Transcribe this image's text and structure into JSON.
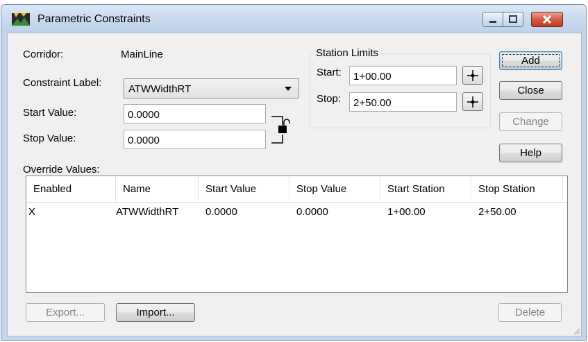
{
  "window": {
    "title": "Parametric Constraints",
    "icon": "app-icon"
  },
  "form": {
    "corridor_label": "Corridor:",
    "corridor_value": "MainLine",
    "constraint_label_label": "Constraint Label:",
    "constraint_label_value": "ATWWidthRT",
    "start_value_label": "Start Value:",
    "start_value": "0.0000",
    "stop_value_label": "Stop Value:",
    "stop_value": "0.0000",
    "override_values_label": "Override Values:"
  },
  "station_limits": {
    "title": "Station Limits",
    "start_label": "Start:",
    "start_value": "1+00.00",
    "stop_label": "Stop:",
    "stop_value": "2+50.00"
  },
  "buttons": {
    "add": "Add",
    "close": "Close",
    "change": "Change",
    "help": "Help",
    "export": "Export...",
    "import": "Import...",
    "delete": "Delete"
  },
  "table": {
    "columns": [
      "Enabled",
      "Name",
      "Start Value",
      "Stop Value",
      "Start Station",
      "Stop Station"
    ],
    "rows": [
      [
        "X",
        "ATWWidthRT",
        "0.0000",
        "0.0000",
        "1+00.00",
        "2+50.00"
      ]
    ]
  }
}
